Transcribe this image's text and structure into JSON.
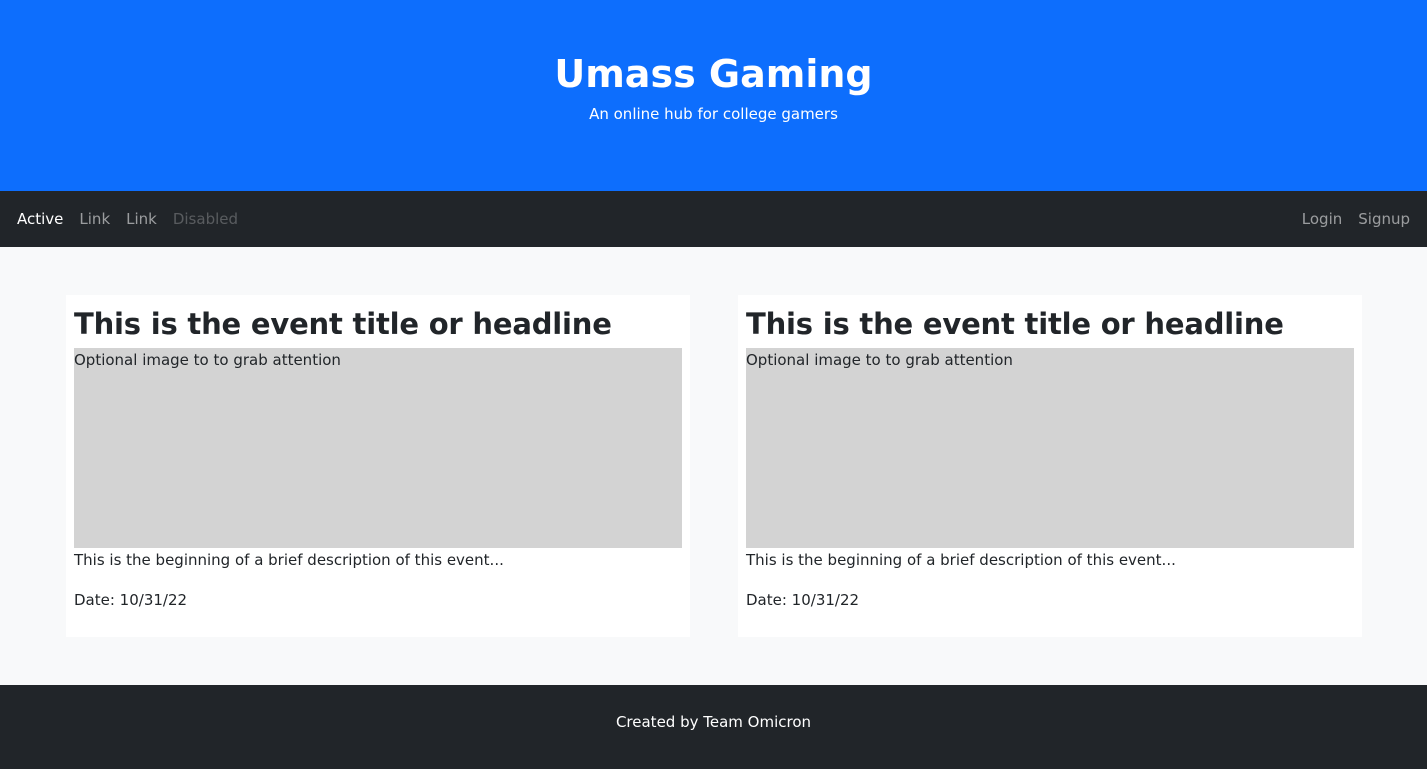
{
  "hero": {
    "title": "Umass Gaming",
    "subtitle": "An online hub for college gamers"
  },
  "navbar": {
    "left_links": [
      {
        "label": "Active",
        "state": "active"
      },
      {
        "label": "Link",
        "state": "normal"
      },
      {
        "label": "Link",
        "state": "normal"
      },
      {
        "label": "Disabled",
        "state": "disabled"
      }
    ],
    "right_links": [
      {
        "label": "Login"
      },
      {
        "label": "Signup"
      }
    ]
  },
  "events": [
    {
      "title": "This is the event title or headline",
      "image_placeholder": "Optional image to to grab attention",
      "description": "This is the beginning of a brief description of this event...",
      "date": "Date: 10/31/22"
    },
    {
      "title": "This is the event title or headline",
      "image_placeholder": "Optional image to to grab attention",
      "description": "This is the beginning of a brief description of this event...",
      "date": "Date: 10/31/22"
    }
  ],
  "footer": {
    "text": "Created by Team Omicron"
  },
  "colors": {
    "hero_bg": "#0d6efd",
    "navbar_bg": "#212529",
    "page_bg": "#f8f9fa",
    "image_placeholder_bg": "#d3d3d3",
    "footer_bg": "#212529"
  }
}
